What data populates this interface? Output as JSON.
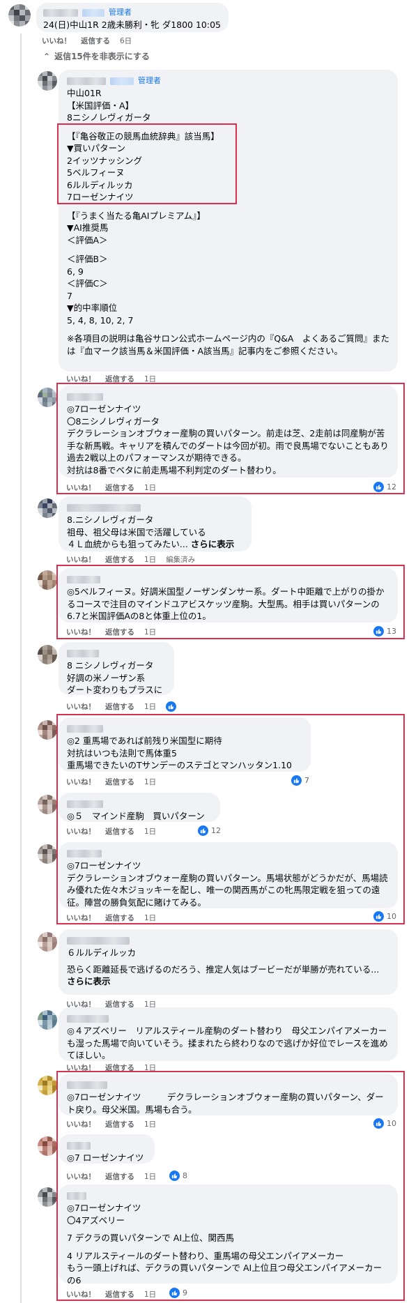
{
  "ui": {
    "like": "いいね！",
    "reply": "返信する",
    "admin": "管理者",
    "see_more": "さらに表示",
    "edited": "編集済み"
  },
  "root": {
    "text": "24(日)中山1R 2歳未勝利・牝 ダ1800 10:05",
    "time": "6日",
    "hide_replies": "返信15件を非表示にする"
  },
  "admin_reply": {
    "lines": [
      "中山01R",
      "【米国評価・A】",
      "8ニシノレヴィガータ"
    ],
    "box_lines": [
      "【『亀谷敬正の競馬血統辞典』該当馬】",
      "▼買いパターン",
      "2イッツナッシング",
      "5ベルフィーヌ",
      "6ルルディルッカ",
      "7ローゼンナイツ"
    ],
    "ai_lines": [
      "【『うまく当たる亀AIプレミアム』】",
      "▼AI推奨馬",
      "＜評価A＞",
      "",
      "＜評価B＞",
      "6, 9",
      "＜評価C＞",
      "7",
      "▼的中率順位",
      "5, 4, 8, 10, 2, 7"
    ],
    "note": "※各項目の説明は亀谷サロン公式ホームページ内の『Q&A　よくあるご質問』または『血マーク該当馬＆米国評価・A該当馬』記事内をご参照ください。",
    "time": "1日"
  },
  "comments": [
    {
      "lines": [
        "◎7ローゼンナイツ",
        "〇8ニシノレヴィガータ",
        "デクラレーションオブウォー産駒の買いパターン。前走は芝、2走前は同産駒が苦手な新馬戦。キャリアを積んでのダートは今回が初。雨で良馬場でないこともあり過去2戦以上のパフォーマンスが期待できる。",
        "対抗は8番でベタに前走馬場不利判定のダート替わり。"
      ],
      "time": "1日",
      "likes": "12"
    },
    {
      "lines": [
        "8.ニシノレヴィガータ",
        "祖母、祖父母は米国で活躍している",
        "４Ｌ血統からも狙ってみたい... "
      ],
      "time": "1日",
      "likes": ""
    },
    {
      "lines": [
        "◎5ベルフィーヌ。好調米国型ノーザンダンサー系。ダート中距離で上がりの掛かるコースで注目のマインドユアビスケッツ産駒。大型馬。相手は買いパターンの6.7と米国評価Aの8と体重上位の1。"
      ],
      "time": "1日",
      "likes": "13"
    },
    {
      "lines": [
        "8 ニシノレヴィガータ",
        "好調の米ノーザン系",
        "ダート変わりもプラスに"
      ],
      "time": "1日",
      "likes": ""
    },
    {
      "lines": [
        "◎2 重馬場であれば前残り米国型に期待",
        "対抗はいつも法則で馬体重5",
        "重馬場できたいのTサンデーのステゴとマンハッタン1.10"
      ],
      "time": "1日",
      "likes": "7"
    },
    {
      "lines": [
        "◎５　マインド産駒　買いパターン"
      ],
      "time": "1日",
      "likes": "12"
    },
    {
      "lines": [
        "◎7ローゼンナイツ",
        "デクラレーションオブウォー産駒の買いパターン。馬場状態がどうかだが、馬場読み優れた佐々木ジョッキーを配し、唯一の関西馬がこの牝馬限定戦を狙っての遠征。陣営の勝負気配に賭けてみる。"
      ],
      "time": "1日",
      "likes": "10"
    },
    {
      "lines": [
        "６ルルディルッカ",
        "",
        "恐らく距離延長で逃げるのだろう、推定人気はブービーだが単勝が売れている... "
      ],
      "time": "1日",
      "likes": ""
    },
    {
      "lines": [
        "◎４アズベリー　リアルスティール産駒のダート替わり　母父エンパイアメーカーも湿った馬場で向いていそう。揉まれたら終わりなので逃げか好位でレースを進めてほしい。"
      ],
      "time": "1日",
      "likes": ""
    },
    {
      "lines": [
        "◎7ローゼンナイツ　　　デクラレーションオブウォー産駒の買いパターン、ダート戻り。母父米国。馬場も合う。"
      ],
      "time": "1日",
      "likes": "10"
    },
    {
      "lines": [
        "◎7 ローゼンナイツ"
      ],
      "time": "1日",
      "likes": "8"
    },
    {
      "lines": [
        "◎7ローゼンナイツ",
        "〇4アズベリー",
        "",
        "7 デクラの買いパターンで AI上位、関西馬",
        "",
        "4 リアルスティールのダート替わり、重馬場の母父エンパイアメーカー",
        "もう一頭上げれば、デクラの買いパターンで AI上位且つ母父エンパイアメーカーの6"
      ],
      "time": "1日",
      "likes": "9"
    }
  ],
  "colors": {
    "highlight": "#d9304f",
    "like": "#1877f2",
    "bubble": "#f0f2f5"
  }
}
